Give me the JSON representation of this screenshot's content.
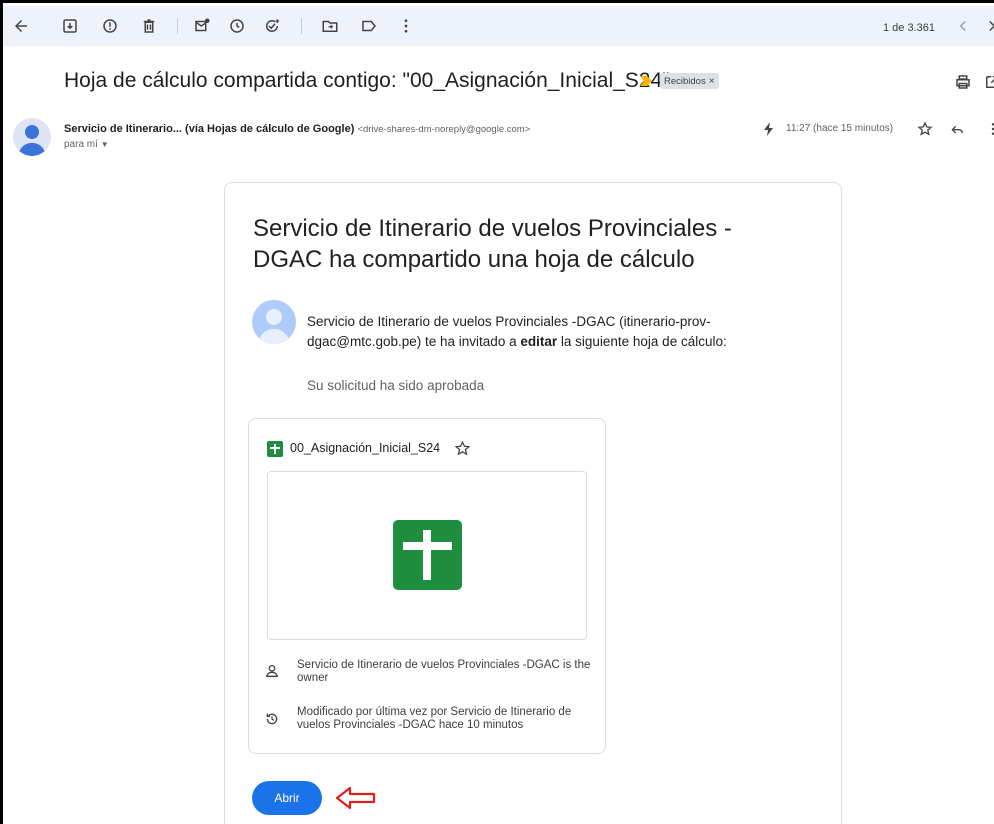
{
  "toolbar": {
    "icons": [
      "back-arrow-icon",
      "archive-icon",
      "report-spam-icon",
      "delete-icon",
      "mark-unread-icon",
      "snooze-icon",
      "add-to-tasks-icon",
      "move-to-icon",
      "label-icon",
      "more-vertical-icon"
    ],
    "pager_text": "1 de 3.361"
  },
  "email": {
    "subject": "Hoja de cálculo compartida contigo: \"00_Asignación_Inicial_S24\"",
    "label": "Recibidos",
    "label_close": "×",
    "sender_name": "Servicio de Itinerario... (vía Hojas de cálculo de Google)",
    "sender_email": "<drive-shares-dm-noreply@google.com>",
    "to_me": "para mí",
    "time": "11:27 (hace 15 minutos)"
  },
  "message": {
    "title": "Servicio de Itinerario de vuelos Provinciales - DGAC ha compartido una hoja de cálculo",
    "invite_prefix": "Servicio de Itinerario de vuelos Provinciales -DGAC (itinerario-prov-dgac@mtc.gob.pe) te ha invitado a ",
    "invite_bold": "editar",
    "invite_suffix": " la siguiente hoja de cálculo:",
    "approved_text": "Su solicitud ha sido aprobada",
    "file_name": "00_Asignación_Inicial_S24",
    "owner_text": "Servicio de Itinerario de vuelos Provinciales -DGAC is the owner",
    "modified_text": "Modificado por última vez por Servicio de Itinerario de vuelos Provinciales -DGAC hace 10 minutos",
    "open_button": "Abrir"
  },
  "colors": {
    "toolbar_bg": "#eef3fb",
    "primary_button": "#1a73e8",
    "sheets_green": "#1e8e3e",
    "annotation_red": "#e0201e",
    "important_marker": "#f4b400"
  }
}
